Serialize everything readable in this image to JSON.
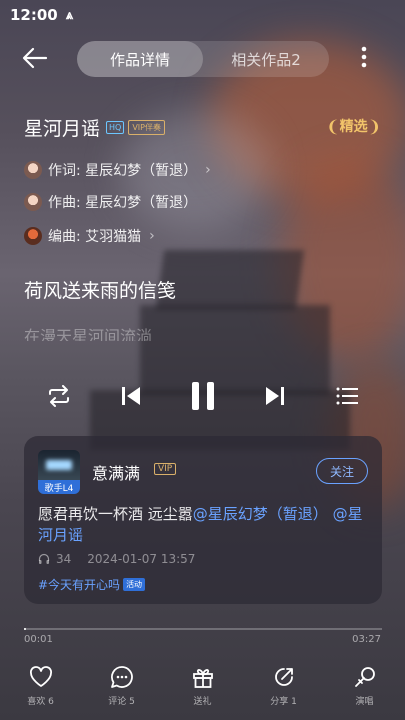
{
  "status_bar": {
    "time": "12:00"
  },
  "nav": {
    "tabs": [
      {
        "label": "作品详情",
        "active": true
      },
      {
        "label": "相关作品2",
        "active": false
      }
    ]
  },
  "song": {
    "title": "星河月谣",
    "badge_hq": "HQ",
    "badge_vip": "VIP伴奏",
    "featured_label": "精选",
    "credits": [
      {
        "label": "作词: 星辰幻梦（暂退）"
      },
      {
        "label": "作曲: 星辰幻梦（暂退）"
      },
      {
        "label": "编曲: 艾羽猫猫"
      }
    ]
  },
  "lyrics": {
    "current": "荷风送来雨的信笺",
    "next": "在漫天星河间流淌"
  },
  "comment": {
    "user_name": "意满满",
    "vip_badge": "VIP",
    "level": "歌手L4",
    "follow_label": "关注",
    "text": "愿君再饮一杯酒 远尘嚣",
    "mention1": "@星辰幻梦（暂退）",
    "mention2": "@星河月谣",
    "listens": "34",
    "date": "2024-01-07 13:57",
    "topic": "#今天有开心吗",
    "topic_tag": "活动"
  },
  "player": {
    "current_time": "00:01",
    "total_time": "03:27",
    "progress": 0.005
  },
  "actions": [
    {
      "label": "喜欢 6",
      "icon": "heart-icon"
    },
    {
      "label": "评论 5",
      "icon": "comment-icon"
    },
    {
      "label": "送礼",
      "icon": "gift-icon"
    },
    {
      "label": "分享 1",
      "icon": "share-icon"
    },
    {
      "label": "演唱",
      "icon": "microphone-icon"
    }
  ],
  "colors": {
    "accent_blue": "#6aa2ff",
    "gold": "#f2c46a"
  }
}
